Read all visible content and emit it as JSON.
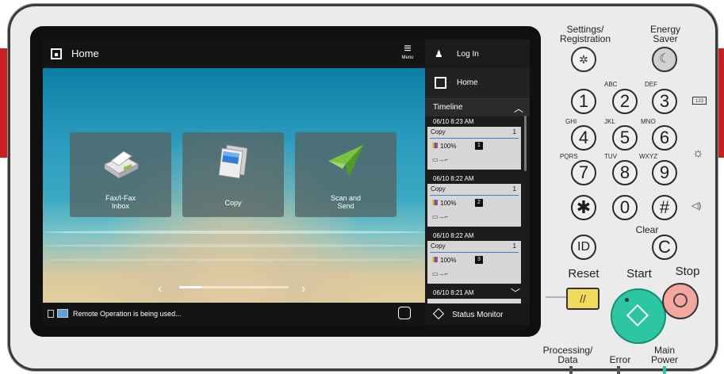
{
  "screen": {
    "topbar": {
      "title": "Home",
      "menu_label": "Menu"
    },
    "tiles": [
      {
        "label": "Fax/I-Fax\nInbox",
        "icon": "fax-inbox-icon"
      },
      {
        "label": "Copy",
        "icon": "copy-icon"
      },
      {
        "label": "Scan and\nSend",
        "icon": "scan-send-icon"
      }
    ],
    "pager": {
      "prev": "‹",
      "next": "›"
    },
    "statusbar": {
      "message": "Remote Operation is being used..."
    },
    "sidebar": {
      "login_label": "Log In",
      "home_label": "Home",
      "timeline_label": "Timeline",
      "jobs": [
        {
          "time": "06/10 8:23 AM",
          "type": "Copy",
          "count": "1",
          "percent": "100%",
          "num": "1"
        },
        {
          "time": "06/10 8:22 AM",
          "type": "Copy",
          "count": "1",
          "percent": "100%",
          "num": "2"
        },
        {
          "time": "06/10 8:22 AM",
          "type": "Copy",
          "count": "1",
          "percent": "100%",
          "num": "3"
        }
      ],
      "partial_job_time": "06/10 8:21 AM",
      "status_monitor_label": "Status Monitor"
    }
  },
  "keypad": {
    "settings_label": "Settings/\nRegistration",
    "energy_label": "Energy\nSaver",
    "keys": [
      {
        "key": "1",
        "letters": ""
      },
      {
        "key": "2",
        "letters": "ABC"
      },
      {
        "key": "3",
        "letters": "DEF"
      },
      {
        "key": "4",
        "letters": "GHI"
      },
      {
        "key": "5",
        "letters": "JKL"
      },
      {
        "key": "6",
        "letters": "MNO"
      },
      {
        "key": "7",
        "letters": "PQRS"
      },
      {
        "key": "8",
        "letters": "TUV"
      },
      {
        "key": "9",
        "letters": "WXYZ"
      },
      {
        "key": "✱",
        "letters": ""
      },
      {
        "key": "0",
        "letters": ""
      },
      {
        "key": "#",
        "letters": ""
      }
    ],
    "clear_label": "Clear",
    "clear_key": "C",
    "id_key": "ID",
    "reset_label": "Reset",
    "start_label": "Start",
    "stop_label": "Stop",
    "counter_icon_text": "123",
    "processing_label": "Processing/\nData",
    "error_label": "Error",
    "main_power_label": "Main\nPower"
  }
}
